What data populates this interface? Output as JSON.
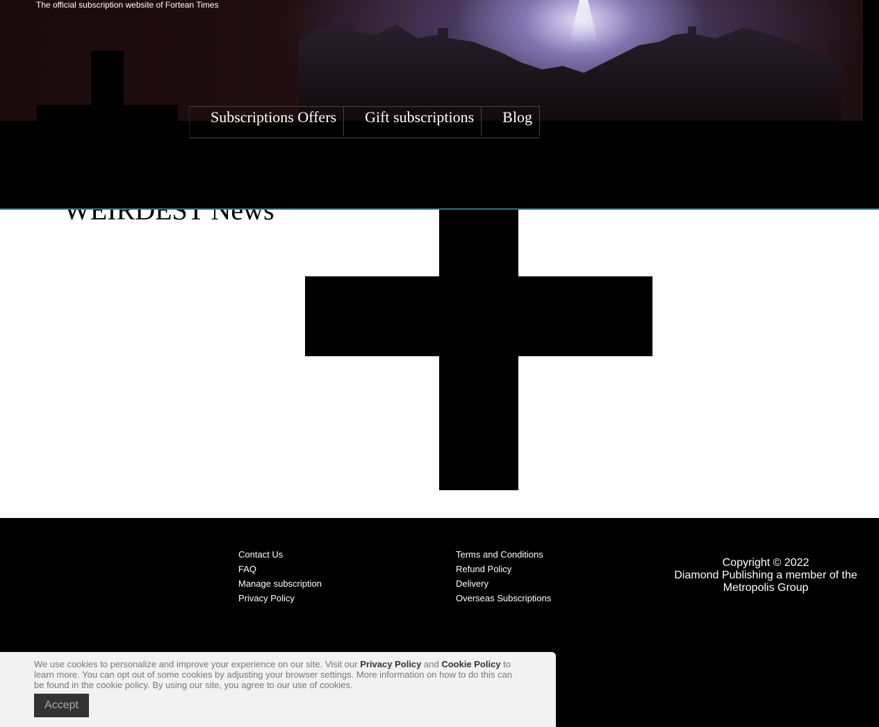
{
  "header": {
    "tagline": "The official subscription website of Fortean Times",
    "nav": [
      {
        "label": "Subscriptions Offers"
      },
      {
        "label": "Gift subscriptions"
      },
      {
        "label": "Blog"
      }
    ]
  },
  "main": {
    "heading": "WEIRDEST News"
  },
  "footer": {
    "col1": [
      "Contact Us",
      "FAQ",
      "Manage subscription",
      "Privacy Policy"
    ],
    "col2": [
      "Terms and Conditions",
      "Refund Policy",
      "Delivery",
      "Overseas Subscriptions"
    ],
    "copyright_line1": "Copyright © 2022",
    "copyright_line2": "Diamond Publishing a member of the Metropolis Group"
  },
  "cookie": {
    "text_before": "We use cookies to personalize and improve your experience on our site. Visit our ",
    "privacy_link": "Privacy Policy",
    "text_and": " and ",
    "cookie_link": "Cookie Policy",
    "text_after": " to learn more. You can opt out of some cookies by adjusting your browser settings. More information on how to do this can be found in the cookie policy. By using our site, you agree to our use of cookies.",
    "accept_label": "Accept"
  }
}
